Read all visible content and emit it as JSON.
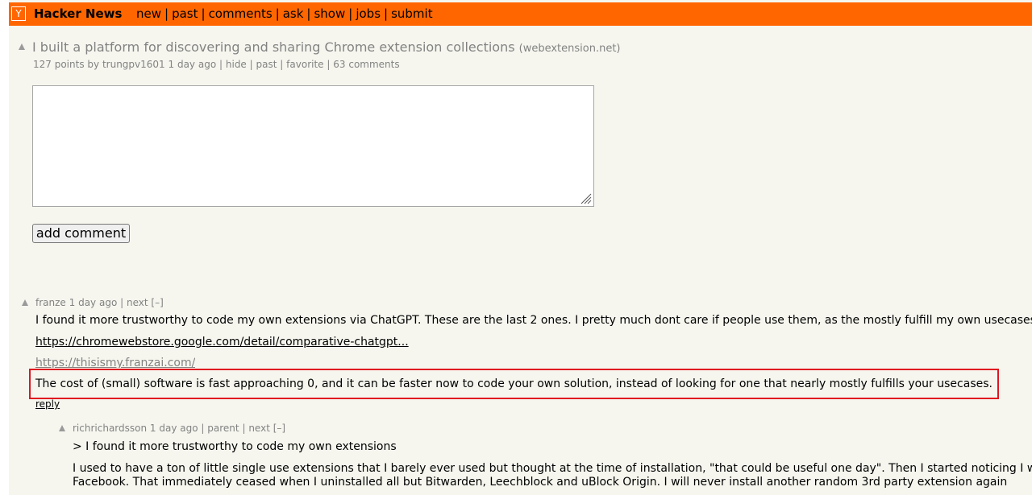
{
  "header": {
    "logo": "Y",
    "site_title": "Hacker News",
    "nav": [
      "new",
      "past",
      "comments",
      "ask",
      "show",
      "jobs",
      "submit"
    ],
    "separator": "|",
    "bg_color": "#ff6600"
  },
  "story": {
    "title": "I built a platform for discovering and sharing Chrome extension collections",
    "site": "(webextension.net)",
    "points": "127 points",
    "by_label": "by",
    "author": "trungpv1601",
    "age": "1 day ago",
    "actions": [
      "hide",
      "past",
      "favorite",
      "63 comments"
    ]
  },
  "comment_form": {
    "textarea_value": "",
    "submit_label": "add comment"
  },
  "comments": [
    {
      "user": "franze",
      "age": "1 day ago",
      "links": [
        "next",
        "[–]"
      ],
      "paragraphs": [
        "I found it more trustworthy to code my own extensions via ChatGPT. These are the last 2 ones. I pretty much dont care if people use them, as the mostly fulfill my own usecases"
      ],
      "url_1": "https://chromewebstore.google.com/detail/comparative-chatgpt...",
      "url_2": "https://thisismy.franzai.com/",
      "highlighted_paragraph": "The cost of (small) software is fast approaching 0, and it can be faster now to code your own solution, instead of looking for one that nearly mostly fulfills your usecases.",
      "reply_label": "reply"
    },
    {
      "user": "richrichardsson",
      "age": "1 day ago",
      "links": [
        "parent",
        "next",
        "[–]"
      ],
      "quote": "> I found it more trustworthy to code my own extensions",
      "paragraph_line_1": "I used to have a ton of little single use extensions that I barely ever used but thought at the time of installation, \"that could be useful one day\". Then I started noticing I was",
      "paragraph_line_2": "Facebook. That immediately ceased when I uninstalled all but Bitwarden, Leechblock and uBlock Origin. I will never install another random 3rd party extension again"
    }
  ]
}
